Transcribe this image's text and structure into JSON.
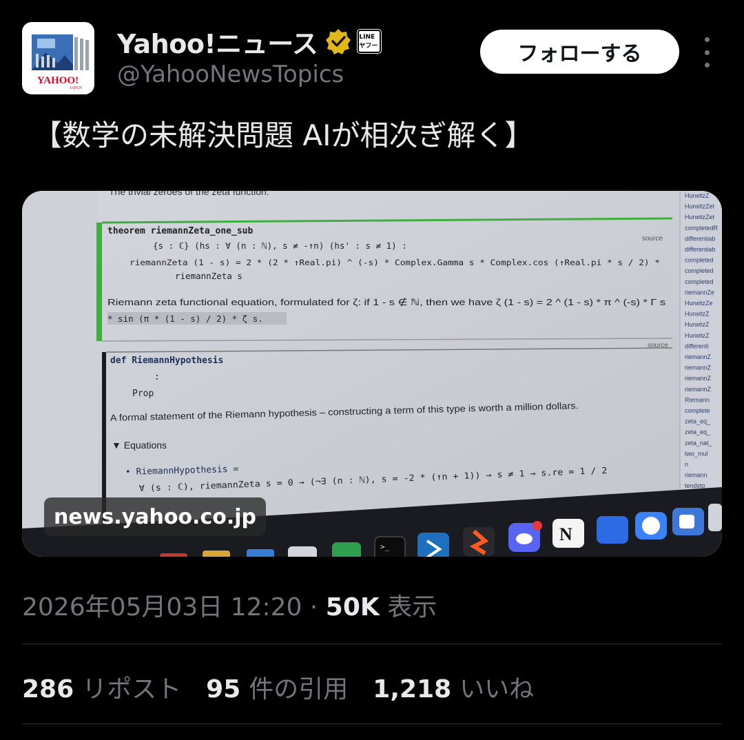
{
  "account": {
    "display_name": "Yahoo!ニュース",
    "handle": "@YahooNewsTopics",
    "avatar_label": "YAHOO!",
    "avatar_sub": "JAPAN",
    "affiliate_badge": "LINEヤフー",
    "verified_color": "#e2b719"
  },
  "follow_button": "フォローする",
  "tweet": {
    "text": "【数学の未解決問題 AIが相次ぎ解く】"
  },
  "media": {
    "link_domain": "news.yahoo.co.jp",
    "screen": {
      "top_line": "The trivial zeroes of the zeta function.",
      "theorem_label": "theorem riemannZeta_one_sub",
      "theorem_args": "{s : ℂ} (hs : ∀ (n : ℕ), s ≠ -↑n) (hs' : s ≠ 1) :",
      "theorem_body": "riemannZeta (1 - s) = 2 * (2 * ↑Real.pi) ^ (-s) * Complex.Gamma s * Complex.cos (↑Real.pi * s / 2) *",
      "theorem_body2": "riemannZeta s",
      "theorem_desc": "Riemann zeta functional equation, formulated for ζ: if 1 - s ∉ ℕ, then we have ζ (1 - s) = 2 ^ (1 - s) * π ^ (-s) * Γ s",
      "theorem_desc2": "* sin (π * (1 - s) / 2) * ζ s.",
      "source_label": "source",
      "def_label": "def RiemannHypothesis",
      "def_colon": ":",
      "def_type": "Prop",
      "def_desc": "A formal statement of the Riemann hypothesis – constructing a term of this type is worth a million dollars.",
      "equations_label": "▼ Equations",
      "eq1": "• RiemannHypothesis =",
      "eq2": "∀ (s : ℂ), riemannZeta s = 0 → (¬∃ (n : ℕ), s = -2 * (↑n + 1)) → s ≠ 1 → s.re = 1 / 2",
      "sidebar_items": [
        "HurwitzZ",
        "HurwitzZet",
        "HurwitzZet",
        "completedR",
        "differentiab",
        "differentiab",
        "completed",
        "completed",
        "completed",
        "riemannZe",
        "HurwitzZe",
        "HurwitzZ",
        "HurwitzZ",
        "HurwitzZ",
        "differenti",
        "riemannZ",
        "riemannZ",
        "riemannZ",
        "riemannZ",
        "Riemann",
        "complete",
        "zeta_eq_",
        "zeta_eq_",
        "zeta_nat_",
        "two_mul",
        "n",
        "riemann",
        "tendsto_"
      ]
    }
  },
  "meta": {
    "timestamp": "2026年05月03日 12:20",
    "separator": " · ",
    "views_count": "50K",
    "views_label": "表示"
  },
  "stats": {
    "reposts_count": "286",
    "reposts_label": "リポスト",
    "quotes_count": "95",
    "quotes_label": "件の引用",
    "likes_count": "1,218",
    "likes_label": "いいね"
  }
}
